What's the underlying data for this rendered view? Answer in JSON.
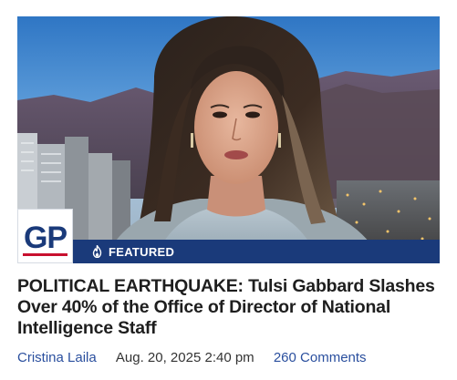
{
  "article": {
    "badge_label": "FEATURED",
    "headline": "POLITICAL EARTHQUAKE: Tulsi Gabbard Slashes Over 40% of the Office of Director of National Intelligence Staff",
    "author": "Cristina Laila",
    "date": "Aug. 20, 2025 2:40 pm",
    "comments": "260 Comments"
  },
  "logo": {
    "text": "GP",
    "icon": "gp-logo"
  },
  "icons": {
    "featured": "flame-icon"
  },
  "colors": {
    "featured_bar": "#1a3a7a",
    "link": "#2a4f9e",
    "logo_blue": "#1a3a7a",
    "logo_red": "#c8102e"
  }
}
